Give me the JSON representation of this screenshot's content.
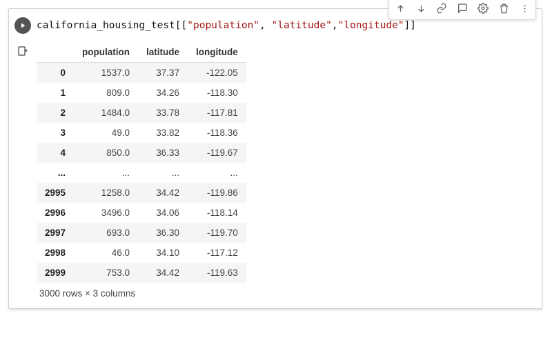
{
  "code": {
    "var": "california_housing_test",
    "brl": "[[",
    "s1": "\"population\"",
    "c1": ", ",
    "s2": "\"latitude\"",
    "c2": ",",
    "s3": "\"longitude\"",
    "brr": "]]"
  },
  "columns": [
    "population",
    "latitude",
    "longitude"
  ],
  "rows": [
    {
      "idx": "0",
      "vals": [
        "1537.0",
        "37.37",
        "-122.05"
      ]
    },
    {
      "idx": "1",
      "vals": [
        "809.0",
        "34.26",
        "-118.30"
      ]
    },
    {
      "idx": "2",
      "vals": [
        "1484.0",
        "33.78",
        "-117.81"
      ]
    },
    {
      "idx": "3",
      "vals": [
        "49.0",
        "33.82",
        "-118.36"
      ]
    },
    {
      "idx": "4",
      "vals": [
        "850.0",
        "36.33",
        "-119.67"
      ]
    },
    {
      "idx": "...",
      "vals": [
        "...",
        "...",
        "..."
      ]
    },
    {
      "idx": "2995",
      "vals": [
        "1258.0",
        "34.42",
        "-119.86"
      ]
    },
    {
      "idx": "2996",
      "vals": [
        "3496.0",
        "34.06",
        "-118.14"
      ]
    },
    {
      "idx": "2997",
      "vals": [
        "693.0",
        "36.30",
        "-119.70"
      ]
    },
    {
      "idx": "2998",
      "vals": [
        "46.0",
        "34.10",
        "-117.12"
      ]
    },
    {
      "idx": "2999",
      "vals": [
        "753.0",
        "34.42",
        "-119.63"
      ]
    }
  ],
  "shape_text": "3000 rows × 3 columns"
}
